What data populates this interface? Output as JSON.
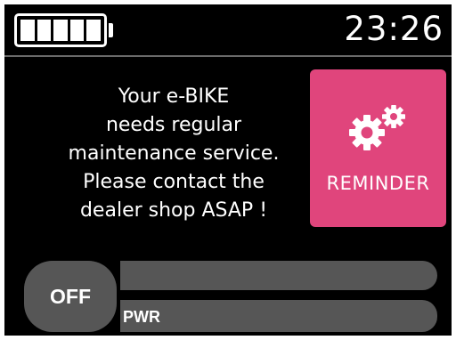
{
  "status_bar": {
    "battery": {
      "icon": "battery-icon",
      "segments_total": 5,
      "segments_filled": 5
    },
    "clock": "23:26"
  },
  "message": {
    "lines": [
      "Your e-BIKE",
      "needs regular",
      "maintenance service.",
      "Please contact the",
      "dealer shop ASAP !"
    ]
  },
  "reminder_tile": {
    "icon": "gears-icon",
    "label": "REMINDER",
    "color": "#e0457c"
  },
  "controls": {
    "off_label": "OFF",
    "power_bar_label": "PWR"
  },
  "colors": {
    "background": "#000000",
    "text": "#ffffff",
    "control_gray": "#565656",
    "accent": "#e0457c"
  }
}
